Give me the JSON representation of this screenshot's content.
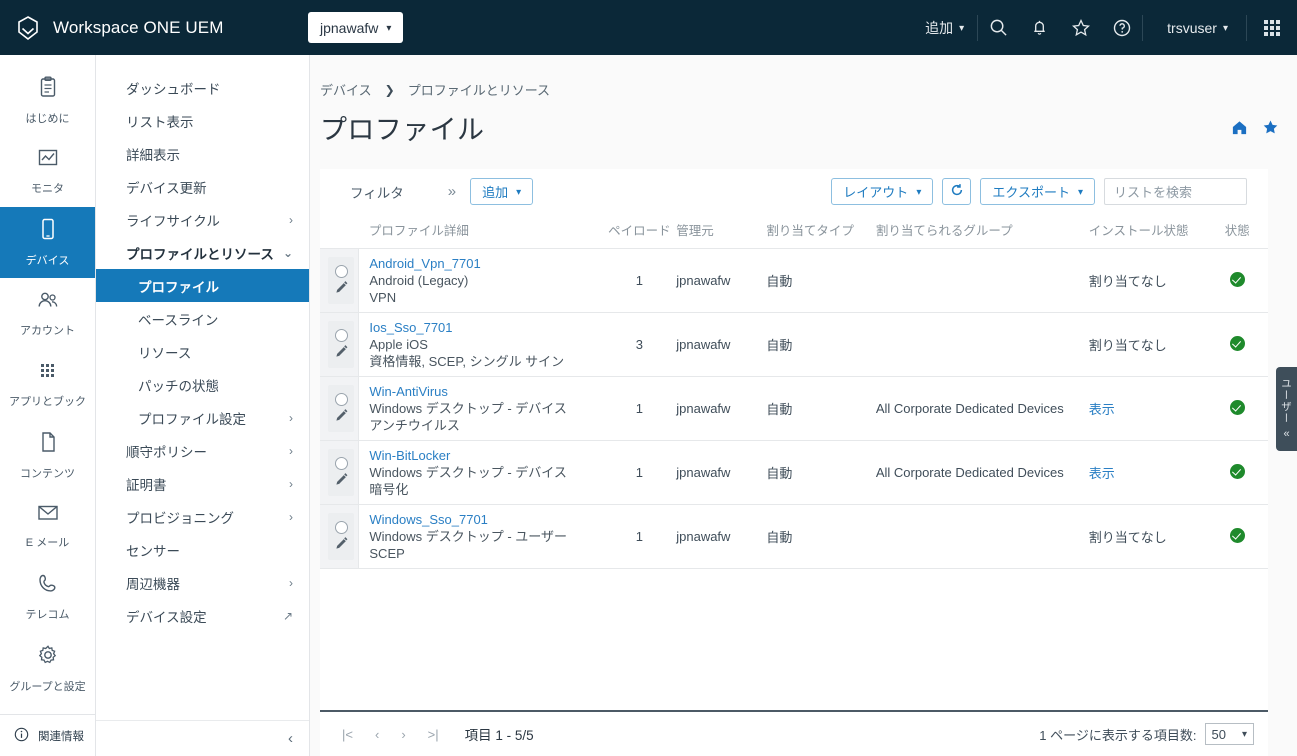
{
  "header": {
    "brand": "Workspace ONE UEM",
    "logo_icon": "workspace-one-logo-icon",
    "org": "jpnawafw",
    "add_label": "追加",
    "icons": [
      "search-icon",
      "bell-icon",
      "star-icon",
      "help-icon"
    ],
    "user": "trsvuser",
    "apps_icon": "app-grid-icon"
  },
  "rail": {
    "items": [
      {
        "label": "はじめに",
        "icon": "clipboard-icon",
        "active": false
      },
      {
        "label": "モニタ",
        "icon": "chart-icon",
        "active": false
      },
      {
        "label": "デバイス",
        "icon": "device-icon",
        "active": true
      },
      {
        "label": "アカウント",
        "icon": "accounts-icon",
        "active": false
      },
      {
        "label": "アプリとブック",
        "icon": "apps-books-icon",
        "active": false
      },
      {
        "label": "コンテンツ",
        "icon": "content-page-icon",
        "active": false
      },
      {
        "label": "E メール",
        "icon": "email-icon",
        "active": false
      },
      {
        "label": "テレコム",
        "icon": "phone-icon",
        "active": false
      },
      {
        "label": "グループと設定",
        "icon": "gear-icon",
        "active": false
      }
    ],
    "footer": {
      "label": "関連情報",
      "icon": "info-icon"
    }
  },
  "nav": {
    "items": [
      {
        "label": "ダッシュボード",
        "chevron": "",
        "style": ""
      },
      {
        "label": "リスト表示",
        "chevron": "",
        "style": ""
      },
      {
        "label": "詳細表示",
        "chevron": "",
        "style": ""
      },
      {
        "label": "デバイス更新",
        "chevron": "",
        "style": ""
      },
      {
        "label": "ライフサイクル",
        "chevron": "›",
        "style": ""
      },
      {
        "label": "プロファイルとリソース",
        "chevron": "⌄",
        "style": "bold"
      },
      {
        "label": "プロファイル",
        "chevron": "",
        "style": "sub active"
      },
      {
        "label": "ベースライン",
        "chevron": "",
        "style": "sub"
      },
      {
        "label": "リソース",
        "chevron": "",
        "style": "sub"
      },
      {
        "label": "パッチの状態",
        "chevron": "",
        "style": "sub"
      },
      {
        "label": "プロファイル設定",
        "chevron": "›",
        "style": "sub"
      },
      {
        "label": "順守ポリシー",
        "chevron": "›",
        "style": ""
      },
      {
        "label": "証明書",
        "chevron": "›",
        "style": ""
      },
      {
        "label": "プロビジョニング",
        "chevron": "›",
        "style": ""
      },
      {
        "label": "センサー",
        "chevron": "",
        "style": ""
      },
      {
        "label": "周辺機器",
        "chevron": "›",
        "style": ""
      },
      {
        "label": "デバイス設定",
        "chevron": "↗",
        "style": ""
      }
    ],
    "collapse_icon": "chevron-left-icon"
  },
  "breadcrumb": {
    "items": [
      "デバイス",
      "プロファイルとリソース"
    ],
    "separator": "❯"
  },
  "page": {
    "title": "プロファイル",
    "home_icon": "home-icon",
    "favorite_icon": "star-filled-icon"
  },
  "toolbar": {
    "filter_label": "フィルタ",
    "filter_more": "»",
    "add_label": "追加",
    "layout_label": "レイアウト",
    "refresh_icon": "refresh-icon",
    "export_label": "エクスポート",
    "search_placeholder": "リストを検索",
    "search_value": ""
  },
  "table": {
    "columns": [
      "",
      "プロファイル詳細",
      "ペイロード",
      "管理元",
      "割り当てタイプ",
      "割り当てられるグループ",
      "インストール状態",
      "状態"
    ],
    "rows": [
      {
        "name": "Android_Vpn_7701",
        "platform": "Android (Legacy)",
        "payload_types": "VPN",
        "payloads": "1",
        "managed_by": "jpnawafw",
        "assignment_type": "自動",
        "assigned_groups": "",
        "install_status": "割り当てなし",
        "install_status_link": false,
        "status": "ok"
      },
      {
        "name": "Ios_Sso_7701",
        "platform": "Apple iOS",
        "payload_types": "資格情報, SCEP, シングル サイン",
        "payloads": "3",
        "managed_by": "jpnawafw",
        "assignment_type": "自動",
        "assigned_groups": "",
        "install_status": "割り当てなし",
        "install_status_link": false,
        "status": "ok"
      },
      {
        "name": "Win-AntiVirus",
        "platform": "Windows デスクトップ - デバイス",
        "payload_types": "アンチウイルス",
        "payloads": "1",
        "managed_by": "jpnawafw",
        "assignment_type": "自動",
        "assigned_groups": "All Corporate Dedicated Devices",
        "install_status": "表示",
        "install_status_link": true,
        "status": "ok"
      },
      {
        "name": "Win-BitLocker",
        "platform": "Windows デスクトップ - デバイス",
        "payload_types": "暗号化",
        "payloads": "1",
        "managed_by": "jpnawafw",
        "assignment_type": "自動",
        "assigned_groups": "All Corporate Dedicated Devices",
        "install_status": "表示",
        "install_status_link": true,
        "status": "ok"
      },
      {
        "name": "Windows_Sso_7701",
        "platform": "Windows デスクトップ - ユーザー",
        "payload_types": "SCEP",
        "payloads": "1",
        "managed_by": "jpnawafw",
        "assignment_type": "自動",
        "assigned_groups": "",
        "install_status": "割り当てなし",
        "install_status_link": false,
        "status": "ok"
      }
    ]
  },
  "footer": {
    "first_icon": "|<",
    "prev_icon": "‹",
    "next_icon": "›",
    "last_icon": ">|",
    "count_text": "項目 1 - 5/5",
    "page_size_label": "1 ページに表示する項目数:",
    "page_size_value": "50"
  },
  "edge_tab": {
    "text": "ユーザー",
    "chevron": "«"
  },
  "colors": {
    "header_bg": "#0b2838",
    "accent": "#1579b9",
    "link": "#2a7fc4",
    "status_ok": "#1f8a2c"
  }
}
